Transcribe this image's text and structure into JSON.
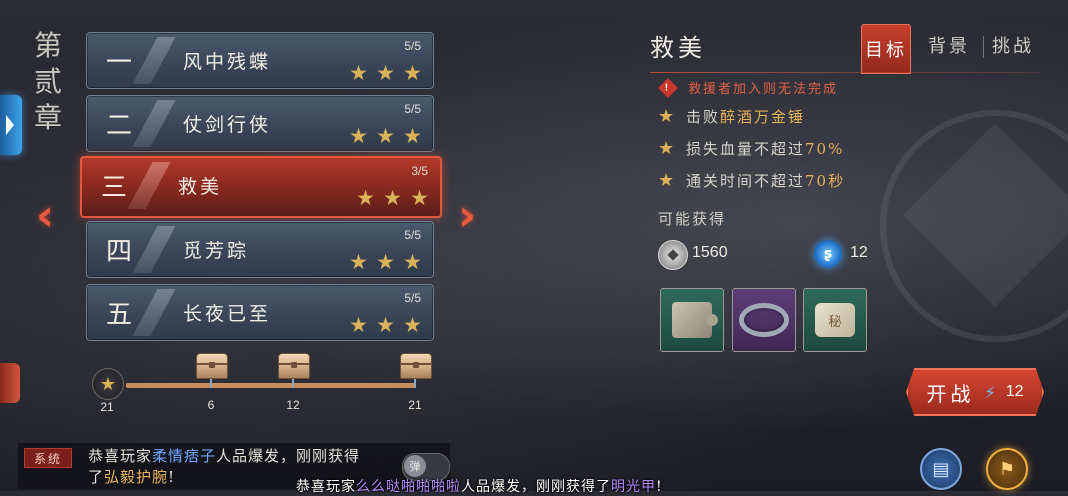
{
  "chapter": {
    "title": "第贰章"
  },
  "levels": [
    {
      "num": "一",
      "name": "风中残蝶",
      "progress": "5/5",
      "stars": 3
    },
    {
      "num": "二",
      "name": "仗剑行侠",
      "progress": "5/5",
      "stars": 3
    },
    {
      "num": "三",
      "name": "救美",
      "progress": "3/5",
      "stars": 3,
      "active": true
    },
    {
      "num": "四",
      "name": "觅芳踪",
      "progress": "5/5",
      "stars": 3
    },
    {
      "num": "五",
      "name": "长夜已至",
      "progress": "5/5",
      "stars": 3
    }
  ],
  "star_progress": {
    "current": "21",
    "milestones": [
      "6",
      "12",
      "21"
    ]
  },
  "stage": {
    "title": "救美",
    "tabs": [
      "目标",
      "背景",
      "挑战"
    ],
    "active_tab": "目标",
    "warning": "救援者加入则无法完成",
    "objectives": [
      {
        "prefix": "击败",
        "highlight": "醉酒万金锤",
        "suffix": ""
      },
      {
        "prefix": "损失血量不超过",
        "highlight": "70%",
        "suffix": ""
      },
      {
        "prefix": "通关时间不超过",
        "highlight": "70秒",
        "suffix": ""
      }
    ],
    "rewards_label": "可能获得",
    "currency": [
      {
        "icon": "silver-coin-icon",
        "value": "1560"
      },
      {
        "icon": "spirit-orb-icon",
        "value": "12"
      }
    ],
    "items": [
      {
        "icon": "puzzle-fragment-icon",
        "rarity": "green"
      },
      {
        "icon": "bracelet-icon",
        "rarity": "purple"
      },
      {
        "icon": "scroll-fragment-icon",
        "rarity": "green",
        "glyph": "秘"
      }
    ]
  },
  "battle_button": {
    "label": "开战",
    "cost": "12"
  },
  "chat": {
    "channel": "系统",
    "line1_prefix": "恭喜玩家",
    "line1_player": "柔情痞子",
    "line1_suffix": "人品爆发，刚刚获得",
    "line2_prefix": "了",
    "line2_item": "弘毅护腕",
    "line2_suffix": "!",
    "danmaku_toggle": "弹"
  },
  "danmaku": {
    "prefix": "恭喜玩家",
    "player": "么么哒啪啪啪啦",
    "middle": "人品爆发，刚刚获得了",
    "item": "明光甲",
    "suffix": "!"
  },
  "colors": {
    "accent_red": "#c8402c",
    "gold": "#e7b259",
    "star": "#d9b25a"
  }
}
